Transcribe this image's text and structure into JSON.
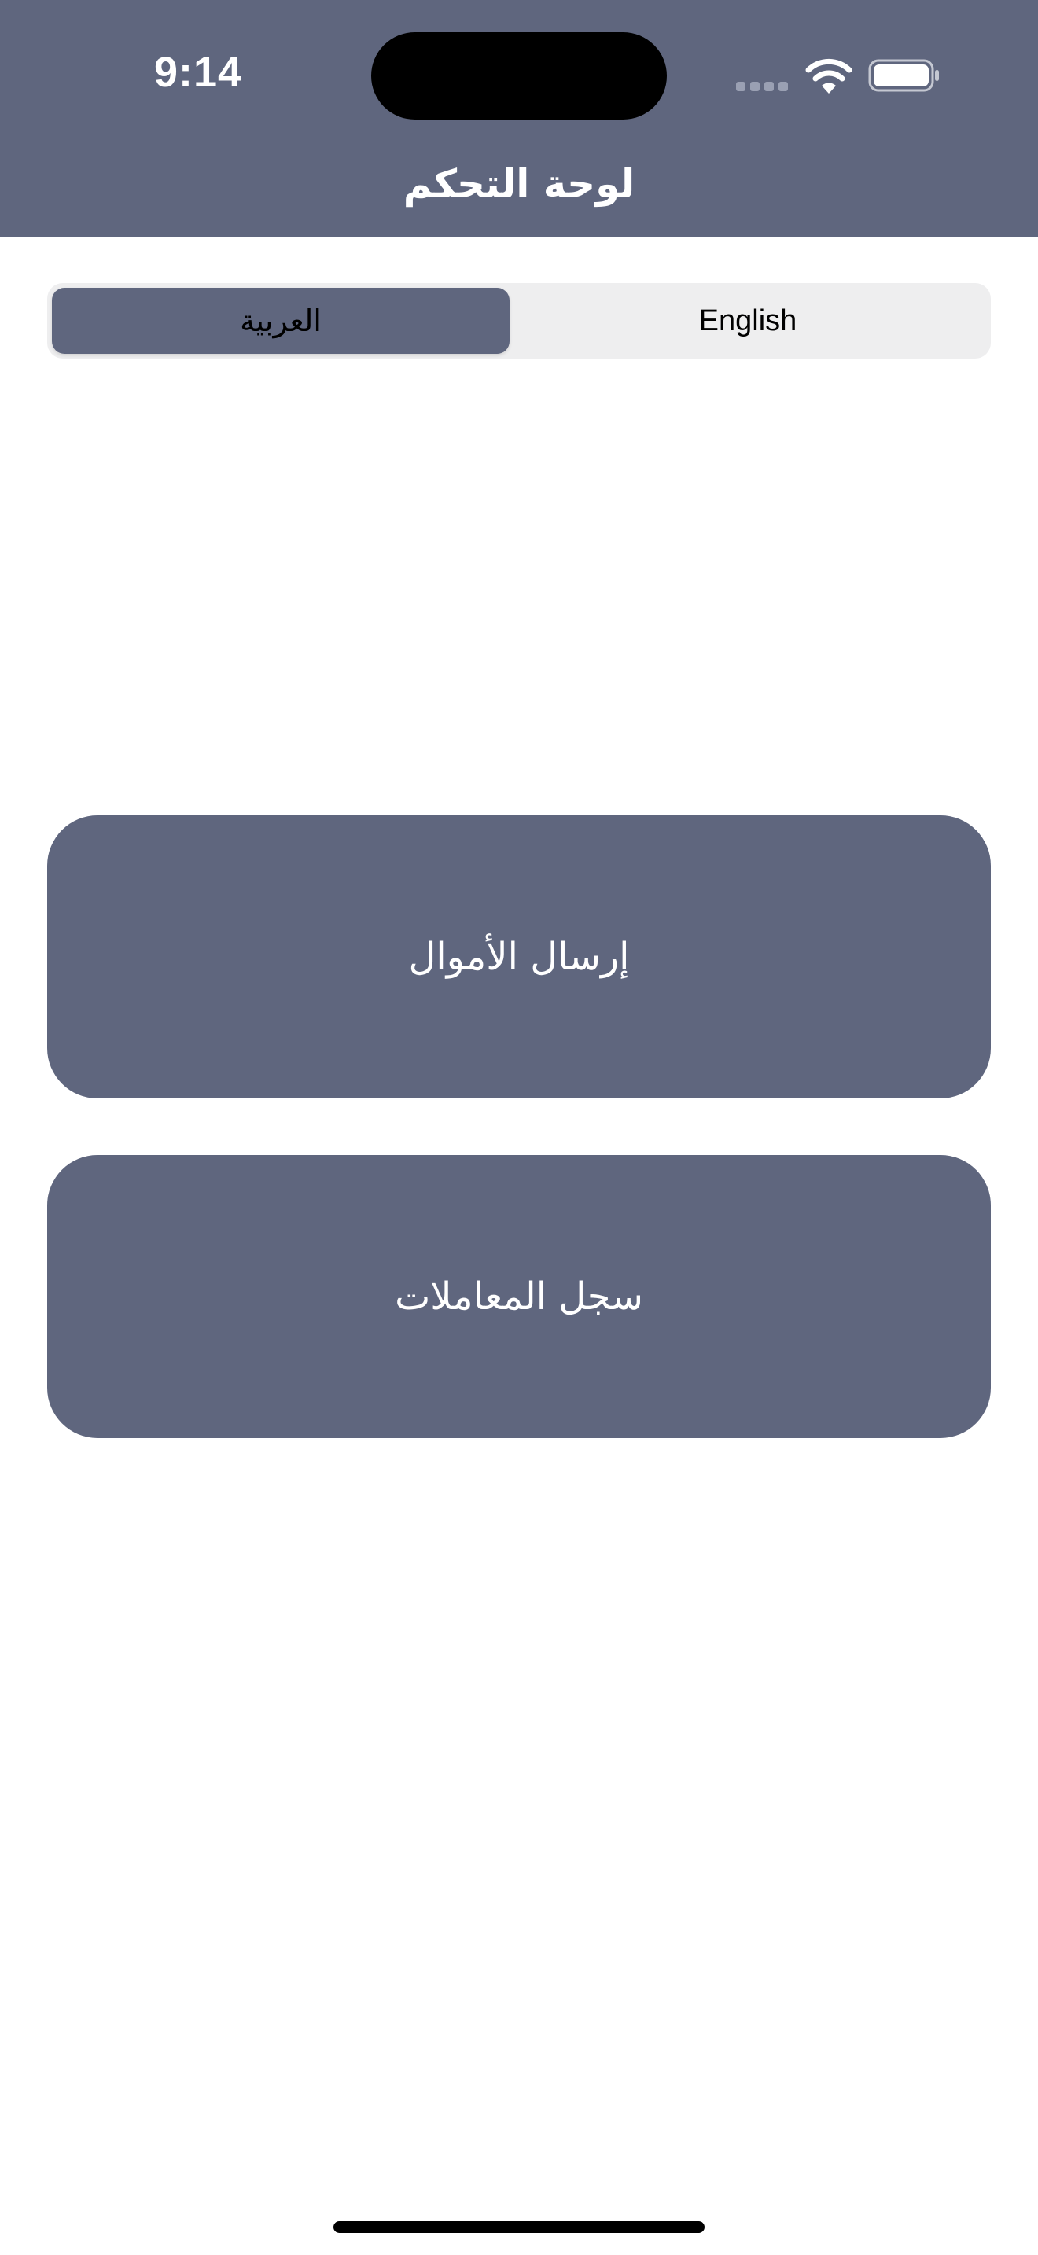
{
  "status_bar": {
    "time": "9:14",
    "icons": [
      "signal-dots-icon",
      "wifi-icon",
      "battery-icon"
    ]
  },
  "header": {
    "title": "لوحة التحكم",
    "background_color": "#5f667e"
  },
  "language_selector": {
    "options": [
      {
        "label": "English",
        "selected": false
      },
      {
        "label": "العربية",
        "selected": true
      }
    ]
  },
  "actions": {
    "send_money": "إرسال الأموال",
    "transaction_history": "سجل المعاملات"
  },
  "colors": {
    "accent": "#5f667e",
    "segment_background": "#eeeeef"
  }
}
